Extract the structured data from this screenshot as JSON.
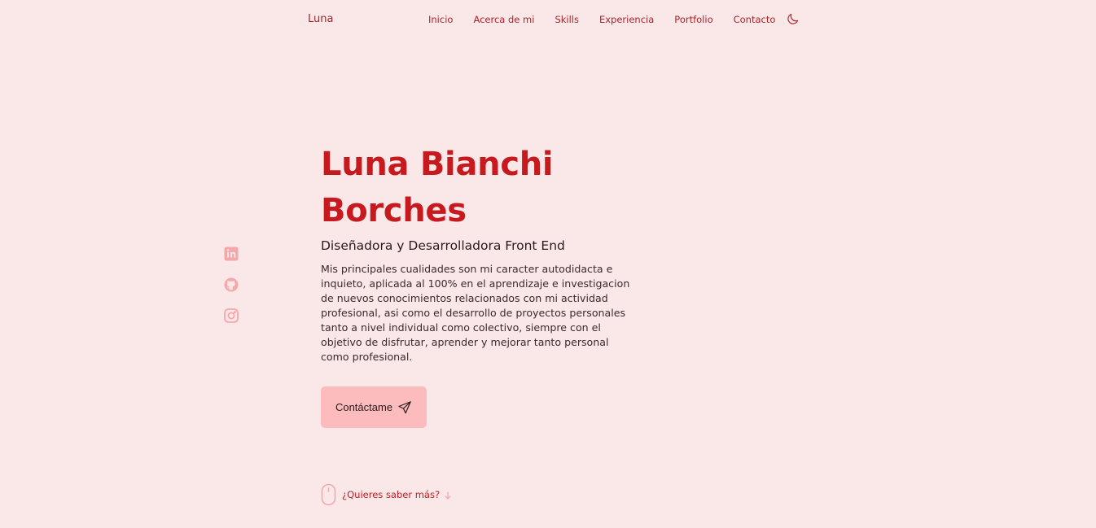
{
  "header": {
    "logo": "Luna",
    "nav": [
      {
        "label": "Inicio"
      },
      {
        "label": "Acerca de mi"
      },
      {
        "label": "Skills"
      },
      {
        "label": "Experiencia"
      },
      {
        "label": "Portfolio"
      },
      {
        "label": "Contacto"
      }
    ],
    "theme_icon": "moon-icon"
  },
  "social": [
    {
      "icon": "linkedin-icon"
    },
    {
      "icon": "github-icon"
    },
    {
      "icon": "instagram-icon"
    }
  ],
  "hero": {
    "title_line1": "Luna Bianchi",
    "title_line2": "Borches",
    "subtitle": "Diseñadora y Desarrolladora Front End",
    "description": "Mis principales cualidades son mi caracter autodidacta e inquieto, aplicada al 100% en el aprendizaje e investigacion de nuevos conocimientos relacionados con mi actividad profesional, asi como el desarrollo de proyectos personales tanto a nivel individual como colectivo, siempre con el objetivo de disfrutar, aprender y mejorar tanto personal como profesional.",
    "cta_label": "Contáctame",
    "cta_icon": "send-icon"
  },
  "scroll": {
    "label": "¿Quieres saber más?",
    "mouse_icon": "mouse-icon",
    "arrow_icon": "arrow-down-icon"
  },
  "colors": {
    "background": "#fae8e9",
    "accent": "#c61a1f",
    "nav_text": "#a8232a",
    "button_bg": "#fcbcbe",
    "social_icon": "#f4a8ab"
  }
}
